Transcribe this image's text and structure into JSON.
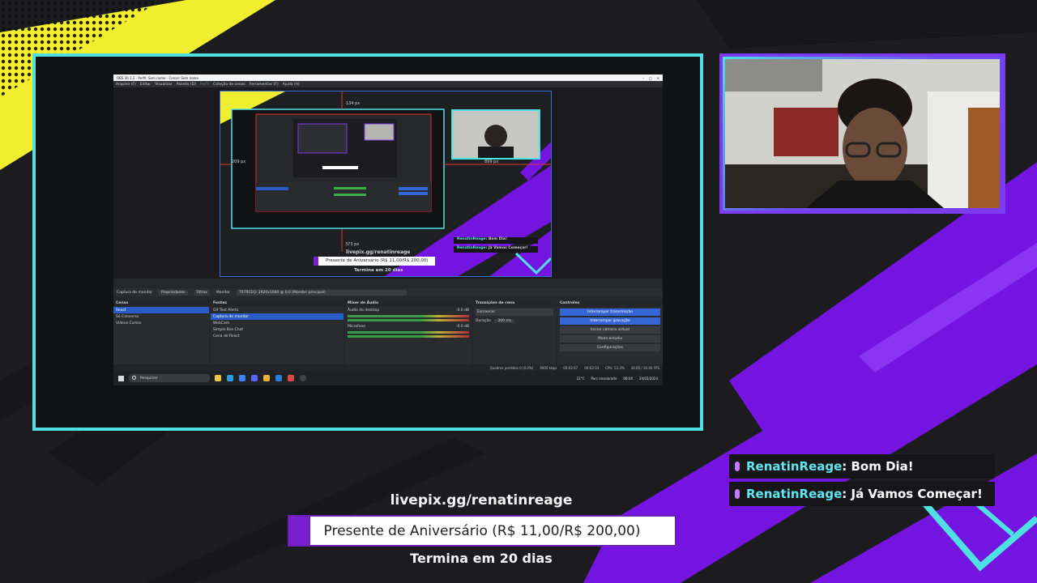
{
  "colors": {
    "accent_cyan": "#4fe0e4",
    "accent_purple": "#7b3bf0",
    "accent_yellow": "#f1ee2f",
    "chat_user": "#5fe6f0",
    "goal_fill": "#7a1fd0"
  },
  "obs": {
    "title": "OBS 30.1.2 - Perfil: Sem nome - Cenas: Sem nome",
    "menu": [
      "Arquivo (F)",
      "Editar",
      "Visualizar",
      "Painéis (D)",
      "Perfil",
      "Coleção de cenas",
      "Ferramentas (F)",
      "Ajuda (H)"
    ],
    "toolbar": {
      "source": "Captura de monitor",
      "properties": "Propriedades",
      "filters": "Filtros",
      "monitor_label": "Monitor",
      "monitor_value": "TX7911Q: 1920x1080 @ 0,0 (Monitor principal)"
    },
    "scenes": {
      "title": "Cenas",
      "items": [
        "React",
        "Só Conversa",
        "Vídeos Curtos"
      ],
      "selected": 0
    },
    "sources": {
      "title": "Fontes",
      "items": [
        "Gif Text Alerts",
        "Captura de monitor",
        "WebCam",
        "Simple Box Chat",
        "Cena de React"
      ],
      "selected": 1
    },
    "mixer": {
      "title": "Mixer de Áudio",
      "channels": [
        {
          "name": "Áudio do desktop",
          "db": "-0.0 dB"
        },
        {
          "name": "Microfone",
          "db": "-0.0 dB"
        }
      ]
    },
    "transitions": {
      "title": "Transições de cena",
      "type": "Esmaecer",
      "duration_label": "Duração",
      "duration": "300 ms"
    },
    "controls": {
      "title": "Controles",
      "buttons": [
        "Interromper transmissão",
        "Interromper gravação",
        "Iniciar câmera virtual",
        "Modo estúdio",
        "Configurações"
      ]
    },
    "status": [
      "Quadros perdidos 0 (0.0%)",
      "9000 kbps",
      "00:02:07",
      "00:02:03",
      "CPU: 53.3%",
      "30.00 / 30.00 FPS"
    ]
  },
  "taskbar": {
    "search_placeholder": "Pesquisar",
    "weather": "22°C",
    "weather_desc": "Parc ensolarado",
    "time": "08:04",
    "date": "24/03/2024"
  },
  "chat": [
    {
      "user": "RenatinReage",
      "message": ": Bom Dia!"
    },
    {
      "user": "RenatinReage",
      "message": ": Já Vamos Começar!"
    }
  ],
  "donation": {
    "link": "livepix.gg/renatinreage",
    "goal_text": "Presente de Aniversário (R$ 11,00/R$ 200,00)",
    "progress": 0.055,
    "ends_in": "Termina em 20 dias"
  },
  "preview_overlay": {
    "guide_top": "134 px",
    "guide_left": "209 px",
    "guide_right": "899 px",
    "guide_bottom": "373 px"
  }
}
